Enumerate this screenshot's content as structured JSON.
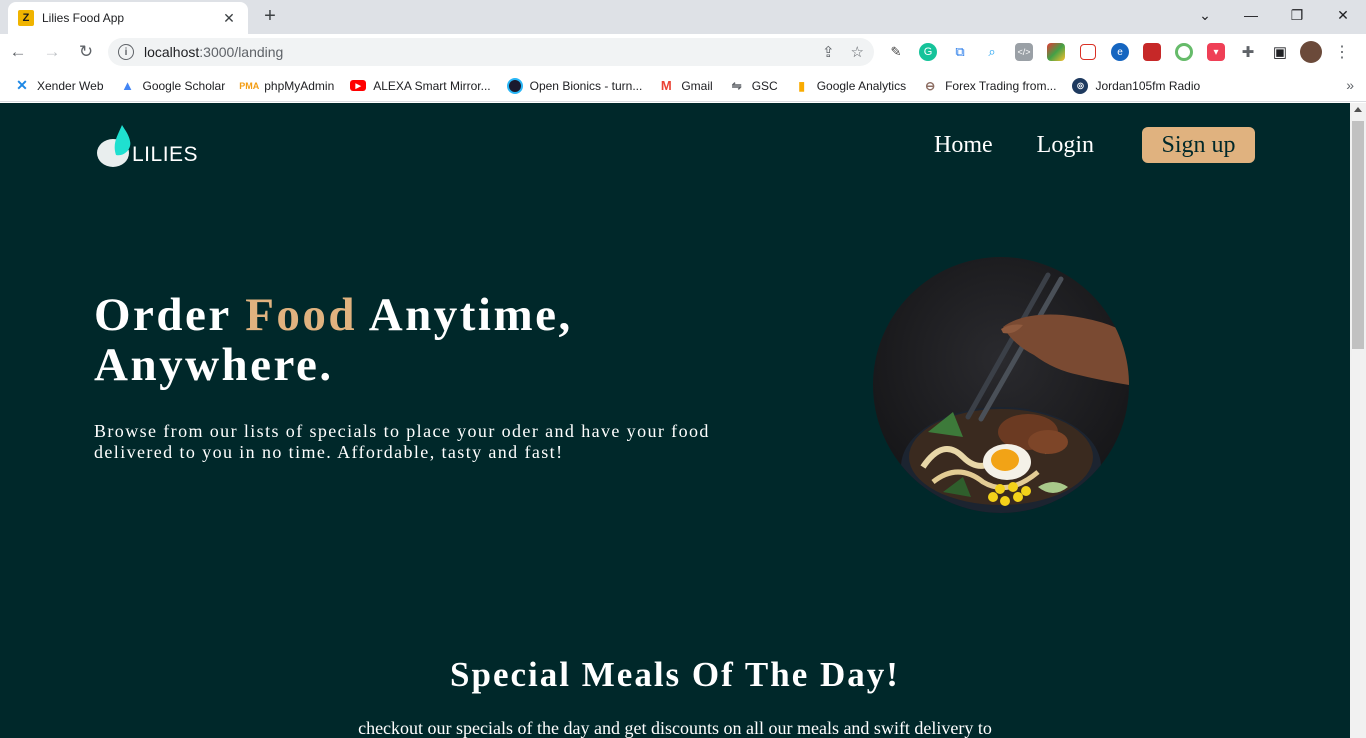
{
  "browser": {
    "tab_title": "Lilies Food App",
    "tab_favicon": "Z",
    "url_host": "localhost",
    "url_path": ":3000/landing",
    "bookmarks": [
      {
        "label": "Xender Web",
        "icon": "xender-icon"
      },
      {
        "label": "Google Scholar",
        "icon": "scholar-icon"
      },
      {
        "label": "phpMyAdmin",
        "icon": "phpmyadmin-icon"
      },
      {
        "label": "ALEXA Smart Mirror...",
        "icon": "youtube-icon"
      },
      {
        "label": "Open Bionics - turn...",
        "icon": "openbionics-icon"
      },
      {
        "label": "Gmail",
        "icon": "gmail-icon"
      },
      {
        "label": "GSC",
        "icon": "gsc-icon"
      },
      {
        "label": "Google Analytics",
        "icon": "analytics-icon"
      },
      {
        "label": "Forex Trading from...",
        "icon": "forex-icon"
      },
      {
        "label": "Jordan105fm Radio",
        "icon": "radio-icon"
      }
    ]
  },
  "site": {
    "logo_text": "LILIES",
    "nav": {
      "home": "Home",
      "login": "Login",
      "signup": "Sign up"
    },
    "hero": {
      "title_part1": "Order ",
      "title_accent": "Food",
      "title_part2": " Anytime,",
      "title_line2": "Anywhere.",
      "subtitle": "Browse from our lists of specials to place your oder and have your food delivered to you in no time. Affordable, tasty and fast!"
    },
    "specials": {
      "title": "Special Meals Of The Day!",
      "subtitle": "checkout our specials of the day and get discounts on all our meals and swift delivery to"
    }
  },
  "colors": {
    "page_bg": "#00282a",
    "accent": "#e0b27f",
    "logo_teal": "#1fe0d0"
  }
}
